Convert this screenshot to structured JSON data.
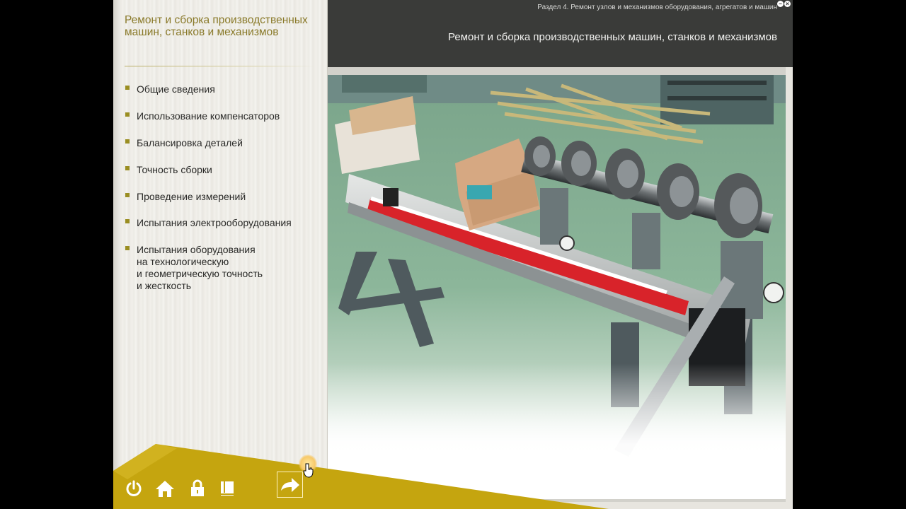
{
  "course": {
    "title": "Ремонт и сборка производственных машин, станков и механизмов"
  },
  "header": {
    "breadcrumb": "Раздел 4. Ремонт узлов и механизмов оборудования, агрегатов и машин",
    "page_title": "Ремонт и сборка производственных машин, станков и механизмов"
  },
  "menu": {
    "items": [
      {
        "label": "Общие сведения"
      },
      {
        "label": "Использование компенсаторов"
      },
      {
        "label": "Балансировка деталей"
      },
      {
        "label": "Точность сборки"
      },
      {
        "label": "Проведение измерений"
      },
      {
        "label": "Испытания электрооборудования"
      },
      {
        "label": "Испытания оборудования\nна технологическую\nи геометрическую точность\nи жесткость"
      }
    ]
  },
  "toolbar": {
    "buttons": [
      {
        "icon": "power-icon"
      },
      {
        "icon": "home-icon"
      },
      {
        "icon": "lock-icon"
      },
      {
        "icon": "book-icon"
      },
      {
        "icon": "next-arrow-icon"
      }
    ]
  },
  "window_controls": {
    "minimize": "−",
    "close": "×"
  },
  "colors": {
    "accent_gold": "#bfa412",
    "header_bg": "#3a3b39",
    "bullet": "#9a8e22",
    "title_text": "#8a7a2a"
  }
}
